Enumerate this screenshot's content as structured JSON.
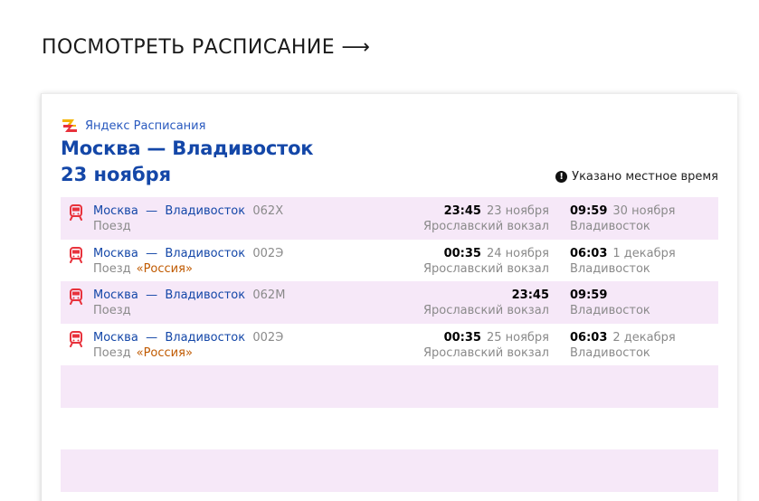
{
  "page": {
    "heading": "ПОСМОТРЕТЬ РАСПИСАНИЕ ⟶"
  },
  "widget": {
    "brand_name": "Яндекс Расписания",
    "route_title": "Москва — Владивосток",
    "date": "23 ноября",
    "timezone_note": "Указано местное время",
    "timezone_icon": "!",
    "rows": [
      {
        "from": "Москва",
        "dash": "—",
        "to": "Владивосток",
        "number": "062Х",
        "kind": "Поезд",
        "train_name": "",
        "dep_time": "23:45",
        "dep_date": "23 ноября",
        "dep_station": "Ярославский вокзал",
        "arr_time": "09:59",
        "arr_date": "30 ноября",
        "arr_station": "Владивосток"
      },
      {
        "from": "Москва",
        "dash": "—",
        "to": "Владивосток",
        "number": "002Э",
        "kind": "Поезд",
        "train_name": "«Россия»",
        "dep_time": "00:35",
        "dep_date": "24 ноября",
        "dep_station": "Ярославский вокзал",
        "arr_time": "06:03",
        "arr_date": "1 декабря",
        "arr_station": "Владивосток"
      },
      {
        "from": "Москва",
        "dash": "—",
        "to": "Владивосток",
        "number": "062М",
        "kind": "Поезд",
        "train_name": "",
        "dep_time": "23:45",
        "dep_date": "",
        "dep_station": "Ярославский вокзал",
        "arr_time": "09:59",
        "arr_date": "",
        "arr_station": "Владивосток"
      },
      {
        "from": "Москва",
        "dash": "—",
        "to": "Владивосток",
        "number": "002Э",
        "kind": "Поезд",
        "train_name": "«Россия»",
        "dep_time": "00:35",
        "dep_date": "25 ноября",
        "dep_station": "Ярославский вокзал",
        "arr_time": "06:03",
        "arr_date": "2 декабря",
        "arr_station": "Владивосток"
      }
    ]
  },
  "colors": {
    "title_blue": "#1447a8",
    "link_blue": "#2a5abf",
    "row_shade": "#f6e8f8",
    "train_icon_red": "#e8323c",
    "train_name_orange": "#c05a00",
    "muted_gray": "#8a8a8a"
  },
  "icons": {
    "brand_logo": "yandex-rasp-logo-icon",
    "train": "train-icon",
    "info": "exclamation-circle-icon"
  }
}
